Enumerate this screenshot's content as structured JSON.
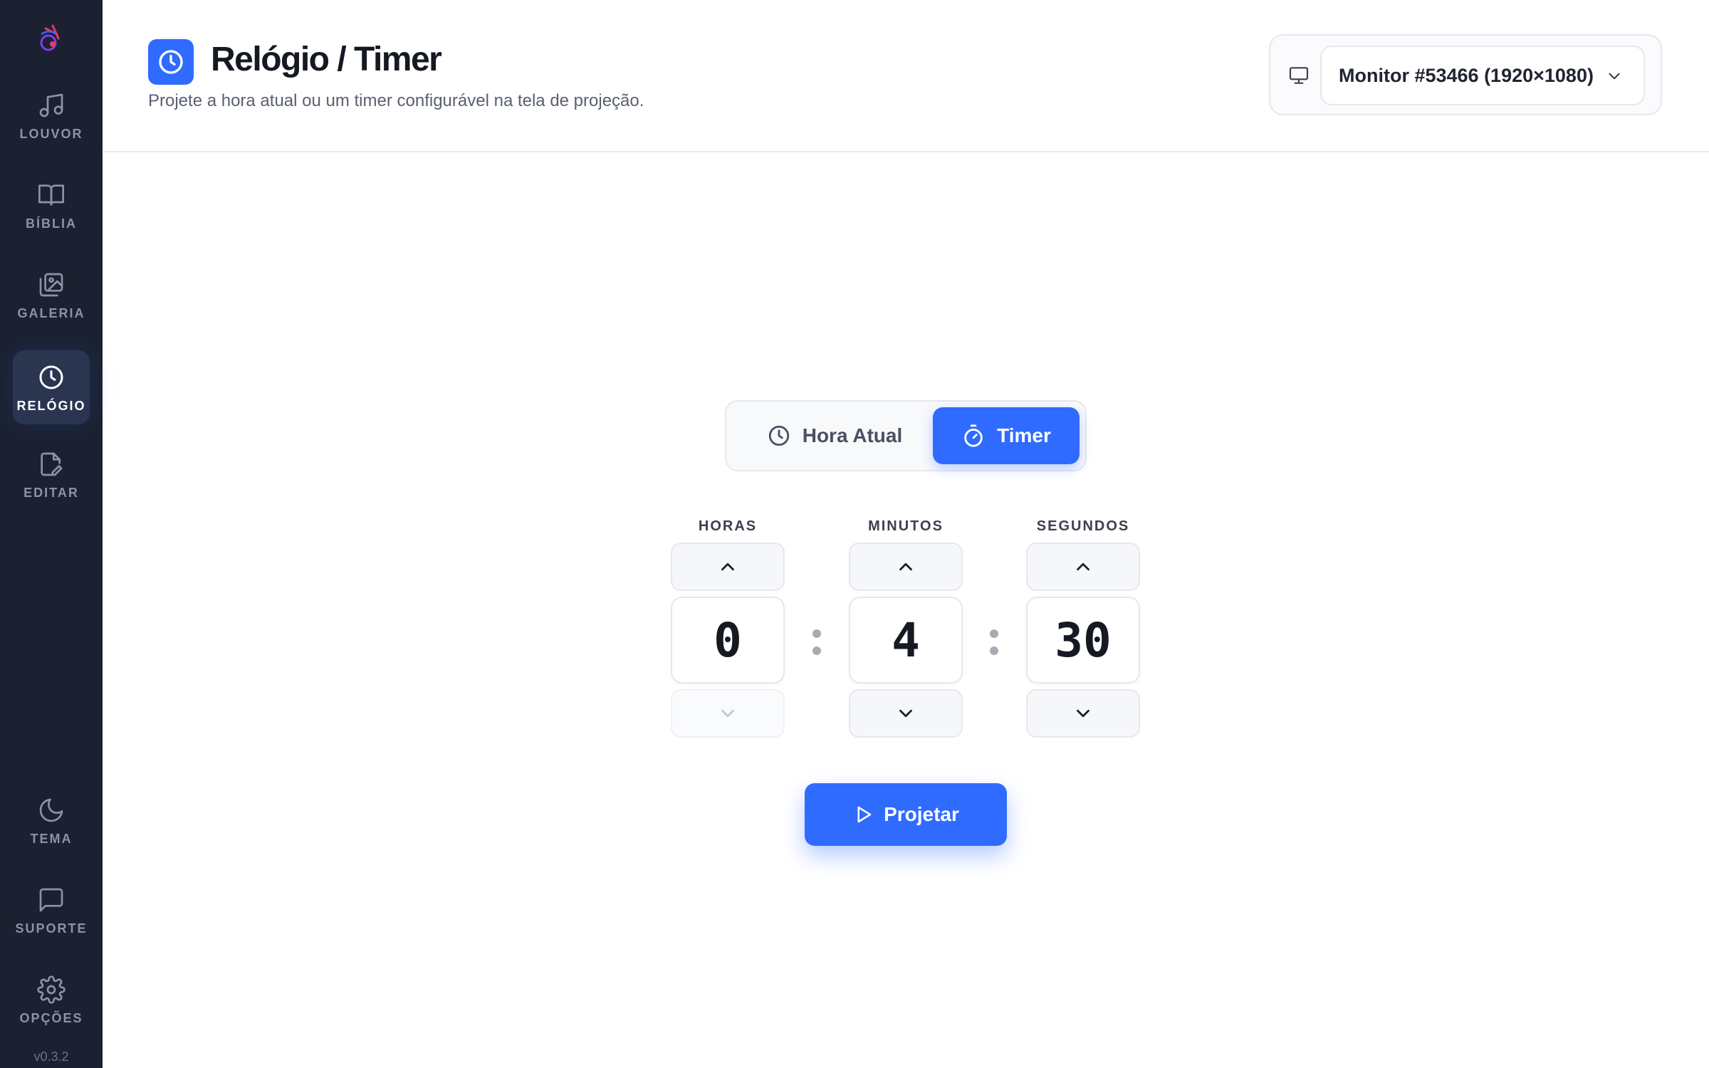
{
  "app": {
    "version": "v0.3.2",
    "accent": "#2f6bff",
    "sidebar_bg": "#1b2130"
  },
  "sidebar": {
    "items": [
      {
        "label": "LOUVOR",
        "icon": "music-note-icon"
      },
      {
        "label": "BÍBLIA",
        "icon": "book-open-icon"
      },
      {
        "label": "GALERIA",
        "icon": "gallery-images-icon"
      },
      {
        "label": "RELÓGIO",
        "icon": "clock-icon",
        "active": true
      },
      {
        "label": "EDITAR",
        "icon": "edit-document-icon"
      }
    ],
    "bottom_items": [
      {
        "label": "TEMA",
        "icon": "moon-icon"
      },
      {
        "label": "SUPORTE",
        "icon": "chat-bubble-icon"
      },
      {
        "label": "OPÇÕES",
        "icon": "gear-icon"
      }
    ]
  },
  "header": {
    "title": "Relógio / Timer",
    "subtitle": "Projete a hora atual ou um timer configurável na tela de projeção.",
    "monitor": "Monitor #53466 (1920×1080)"
  },
  "mode": {
    "options": [
      {
        "label": "Hora Atual",
        "icon": "clock-icon"
      },
      {
        "label": "Timer",
        "icon": "stopwatch-icon"
      }
    ],
    "selected": "Timer"
  },
  "timer": {
    "hours_label": "HORAS",
    "minutes_label": "MINUTOS",
    "seconds_label": "SEGUNDOS",
    "hours": "0",
    "minutes": "4",
    "seconds": "30"
  },
  "actions": {
    "project_label": "Projetar"
  }
}
